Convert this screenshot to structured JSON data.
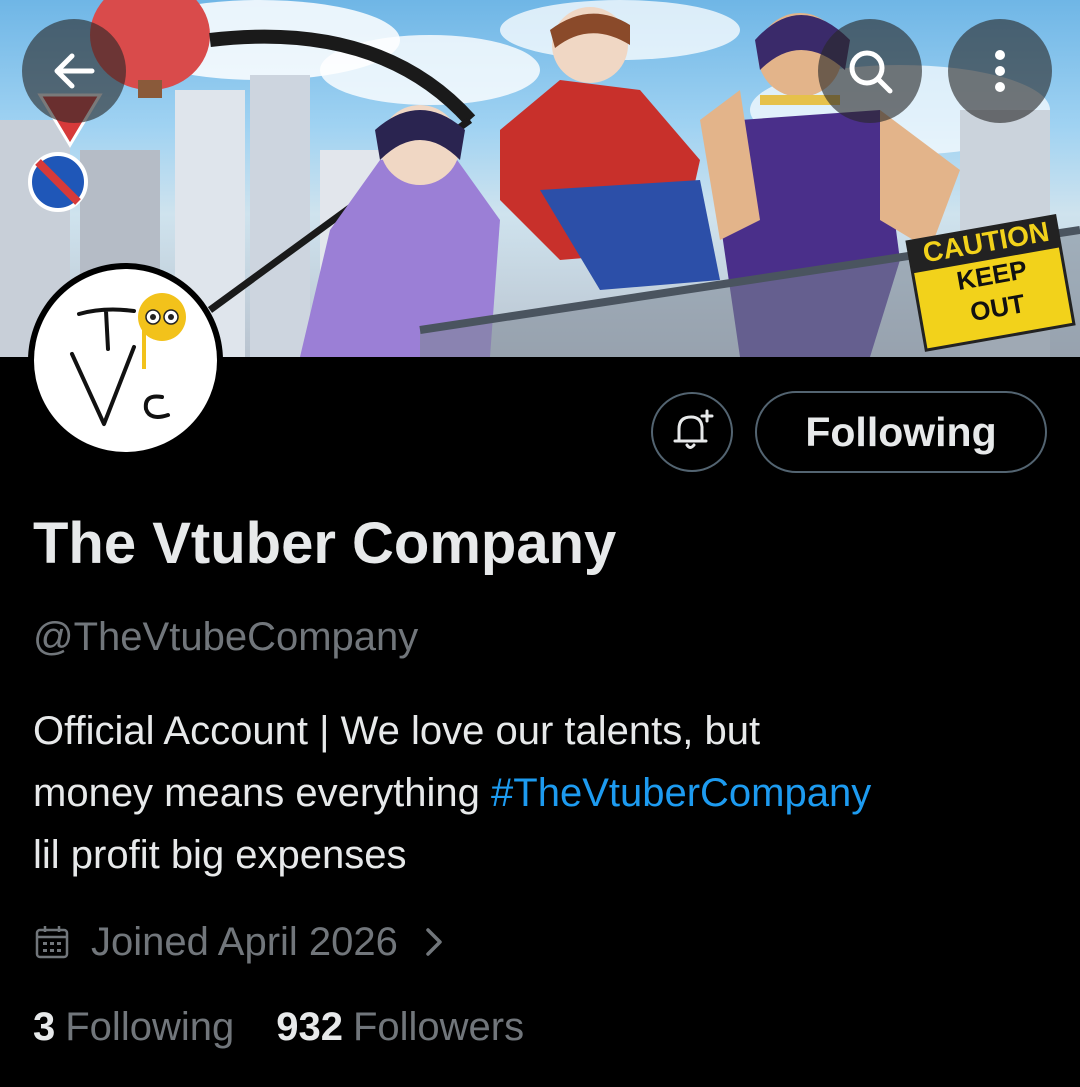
{
  "banner": {
    "sign_caution_line1": "CAUTION",
    "sign_caution_line2": "KEEP",
    "sign_caution_line3": "OUT"
  },
  "header": {
    "back_icon": "arrow-left-icon",
    "search_icon": "search-icon",
    "more_icon": "more-vertical-icon"
  },
  "profile": {
    "avatar_text": "TVc",
    "display_name": "The Vtuber Company",
    "handle": "@TheVtubeCompany",
    "bio_line1": "Official Account | We love our talents, but",
    "bio_line2_prefix": "money means everything ",
    "bio_hashtag": "#TheVtuberCompany",
    "bio_line3": "lil profit big expenses",
    "joined": "Joined April 2026",
    "following_count": "3",
    "following_label": "Following",
    "followers_count": "932",
    "followers_label": "Followers"
  },
  "actions": {
    "notify_icon": "bell-plus-icon",
    "follow_button_label": "Following"
  },
  "colors": {
    "background": "#000000",
    "text_primary": "#e7e9ea",
    "text_secondary": "#71767b",
    "link": "#1d9bf0",
    "button_border": "#536471"
  }
}
